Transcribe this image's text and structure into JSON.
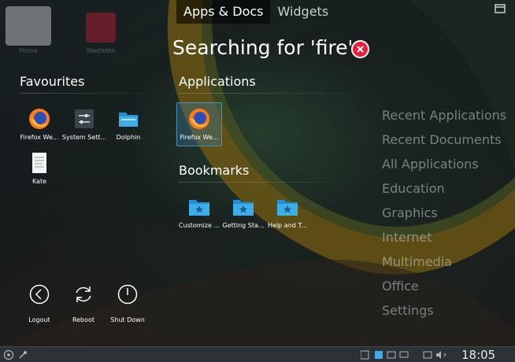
{
  "desktop": {
    "icons": [
      {
        "label": "Home"
      },
      {
        "label": "Wastebin"
      }
    ]
  },
  "tabs": [
    {
      "label": "Apps & Docs",
      "active": true
    },
    {
      "label": "Widgets",
      "active": false
    }
  ],
  "search": {
    "heading": "Searching for 'fire'"
  },
  "favourites": {
    "title": "Favourites",
    "items": [
      {
        "label": "Firefox We...",
        "icon": "firefox-icon"
      },
      {
        "label": "System Sett...",
        "icon": "system-settings-icon"
      },
      {
        "label": "Dolphin",
        "icon": "dolphin-folder-icon"
      },
      {
        "label": "Kate",
        "icon": "kate-editor-icon"
      }
    ]
  },
  "applications": {
    "title": "Applications",
    "items": [
      {
        "label": "Firefox We...",
        "icon": "firefox-icon"
      }
    ]
  },
  "bookmarks": {
    "title": "Bookmarks",
    "items": [
      {
        "label": "Customize ...",
        "icon": "bookmark-folder-icon"
      },
      {
        "label": "Getting Sta...",
        "icon": "bookmark-folder-icon"
      },
      {
        "label": "Help and T...",
        "icon": "bookmark-folder-icon"
      }
    ]
  },
  "categories": [
    "Recent Applications",
    "Recent Documents",
    "All Applications",
    "Education",
    "Graphics",
    "Internet",
    "Multimedia",
    "Office",
    "Settings"
  ],
  "power": [
    {
      "label": "Logout",
      "icon": "logout-icon"
    },
    {
      "label": "Reboot",
      "icon": "reboot-icon"
    },
    {
      "label": "Shut Down",
      "icon": "shutdown-icon"
    }
  ],
  "taskbar": {
    "clock": "18:05"
  },
  "colors": {
    "accent": "#3daee9",
    "clear": "#ee1d3a",
    "folder": "#3daee9",
    "category_text": "#c8ced2"
  }
}
